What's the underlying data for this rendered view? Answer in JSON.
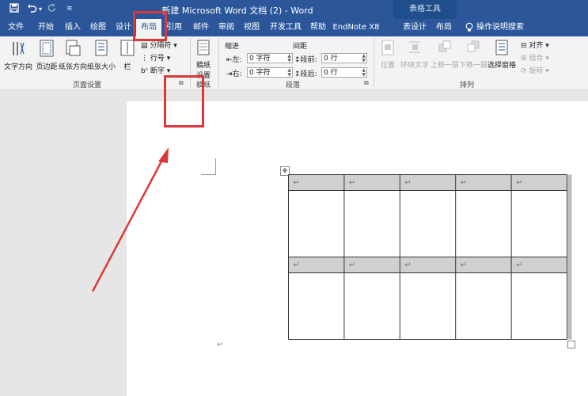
{
  "window": {
    "title": "新建 Microsoft Word 文档 (2)  -  Word",
    "context_tab_group": "表格工具"
  },
  "quick_access": {
    "save_icon": "save-icon",
    "undo_icon": "undo-icon",
    "redo_icon": "redo-icon",
    "customize_icon": "customize-icon"
  },
  "tabs": [
    {
      "label": "文件"
    },
    {
      "label": "开始"
    },
    {
      "label": "插入"
    },
    {
      "label": "绘图"
    },
    {
      "label": "设计"
    },
    {
      "label": "布局",
      "active": true
    },
    {
      "label": "引用"
    },
    {
      "label": "邮件"
    },
    {
      "label": "审阅"
    },
    {
      "label": "视图"
    },
    {
      "label": "开发工具"
    },
    {
      "label": "帮助"
    },
    {
      "label": "EndNote X8"
    },
    {
      "label": "表设计"
    },
    {
      "label": "布局"
    }
  ],
  "tell_me": "操作说明搜索",
  "page_setup": {
    "text_direction": "文字方向",
    "margins": "页边距",
    "orientation": "纸张方向",
    "size": "纸张大小",
    "columns": "栏",
    "breaks": "分隔符",
    "line_numbers": "行号",
    "hyphenation": "断字",
    "group_label": "页面设置"
  },
  "paper": {
    "label_line1": "稿纸",
    "label_line2": "设置",
    "group_label": "稿纸"
  },
  "paragraph": {
    "indent_header": "缩进",
    "spacing_header": "间距",
    "left_label": "左:",
    "left_value": "0 字符",
    "right_label": "右:",
    "right_value": "0 字符",
    "before_label": "段前:",
    "before_value": "0 行",
    "after_label": "段后:",
    "after_value": "0 行",
    "group_label": "段落"
  },
  "arrange": {
    "position": "位置",
    "wrap_text": "环绕文字",
    "bring_forward": "上移一层",
    "send_backward": "下移一层",
    "selection_pane": "选择窗格",
    "align": "对齐",
    "group": "组合",
    "rotate": "旋转",
    "group_label": "排列"
  },
  "document": {
    "paragraph_mark": "↵",
    "table_move_handle": "✥",
    "rows": 4,
    "cols": 5
  },
  "colors": {
    "brand": "#2b579a",
    "annotation": "#d9383a",
    "header_row": "#d0d0d0"
  }
}
